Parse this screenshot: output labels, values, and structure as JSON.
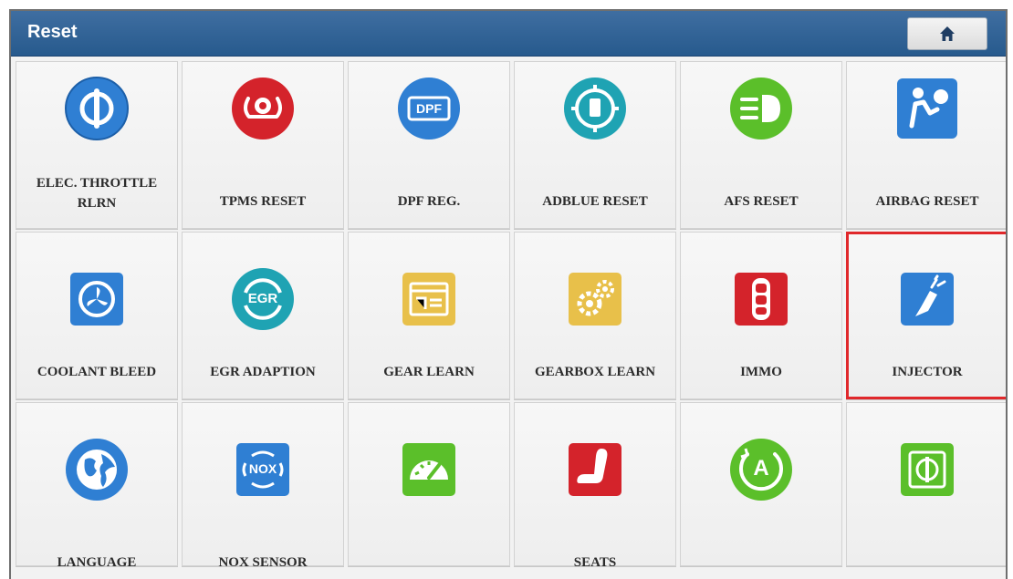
{
  "header": {
    "title": "Reset",
    "home_icon": "home-icon"
  },
  "tiles": [
    {
      "label": "ELEC. THROTTLE RLRN",
      "icon": "throttle-icon",
      "color": "#2f7fd3"
    },
    {
      "label": "TPMS RESET",
      "icon": "tpms-icon",
      "color": "#d4232b"
    },
    {
      "label": "DPF REG.",
      "icon": "dpf-icon",
      "color": "#2f7fd3",
      "icon_text": "DPF"
    },
    {
      "label": "ADBLUE RESET",
      "icon": "adblue-icon",
      "color": "#1fa3b3"
    },
    {
      "label": "AFS RESET",
      "icon": "afs-headlight-icon",
      "color": "#5bbf2a"
    },
    {
      "label": "AIRBAG RESET",
      "icon": "airbag-icon",
      "color": "#2f7fd3"
    },
    {
      "label": "COOLANT BLEED",
      "icon": "coolant-fan-icon",
      "color": "#2f7fd3"
    },
    {
      "label": "EGR ADAPTION",
      "icon": "egr-icon",
      "color": "#1fa3b3",
      "icon_text": "EGR"
    },
    {
      "label": "GEAR LEARN",
      "icon": "gear-learn-icon",
      "color": "#e8c04a"
    },
    {
      "label": "GEARBOX LEARN",
      "icon": "gearbox-gears-icon",
      "color": "#e8c04a"
    },
    {
      "label": "IMMO",
      "icon": "immo-key-icon",
      "color": "#d4232b"
    },
    {
      "label": "INJECTOR",
      "icon": "injector-icon",
      "color": "#2f7fd3"
    },
    {
      "label": "LANGUAGE",
      "icon": "globe-icon",
      "color": "#2f7fd3"
    },
    {
      "label": "NOX SENSOR",
      "icon": "nox-icon",
      "color": "#2f7fd3",
      "icon_text": "NOX"
    },
    {
      "label": "",
      "icon": "gauge-icon",
      "color": "#5bbf2a"
    },
    {
      "label": "SEATS",
      "icon": "seat-icon",
      "color": "#d4232b"
    },
    {
      "label": "",
      "icon": "auto-start-stop-icon",
      "color": "#5bbf2a",
      "icon_text": "A"
    },
    {
      "label": "",
      "icon": "steering-angle-icon",
      "color": "#5bbf2a"
    }
  ]
}
